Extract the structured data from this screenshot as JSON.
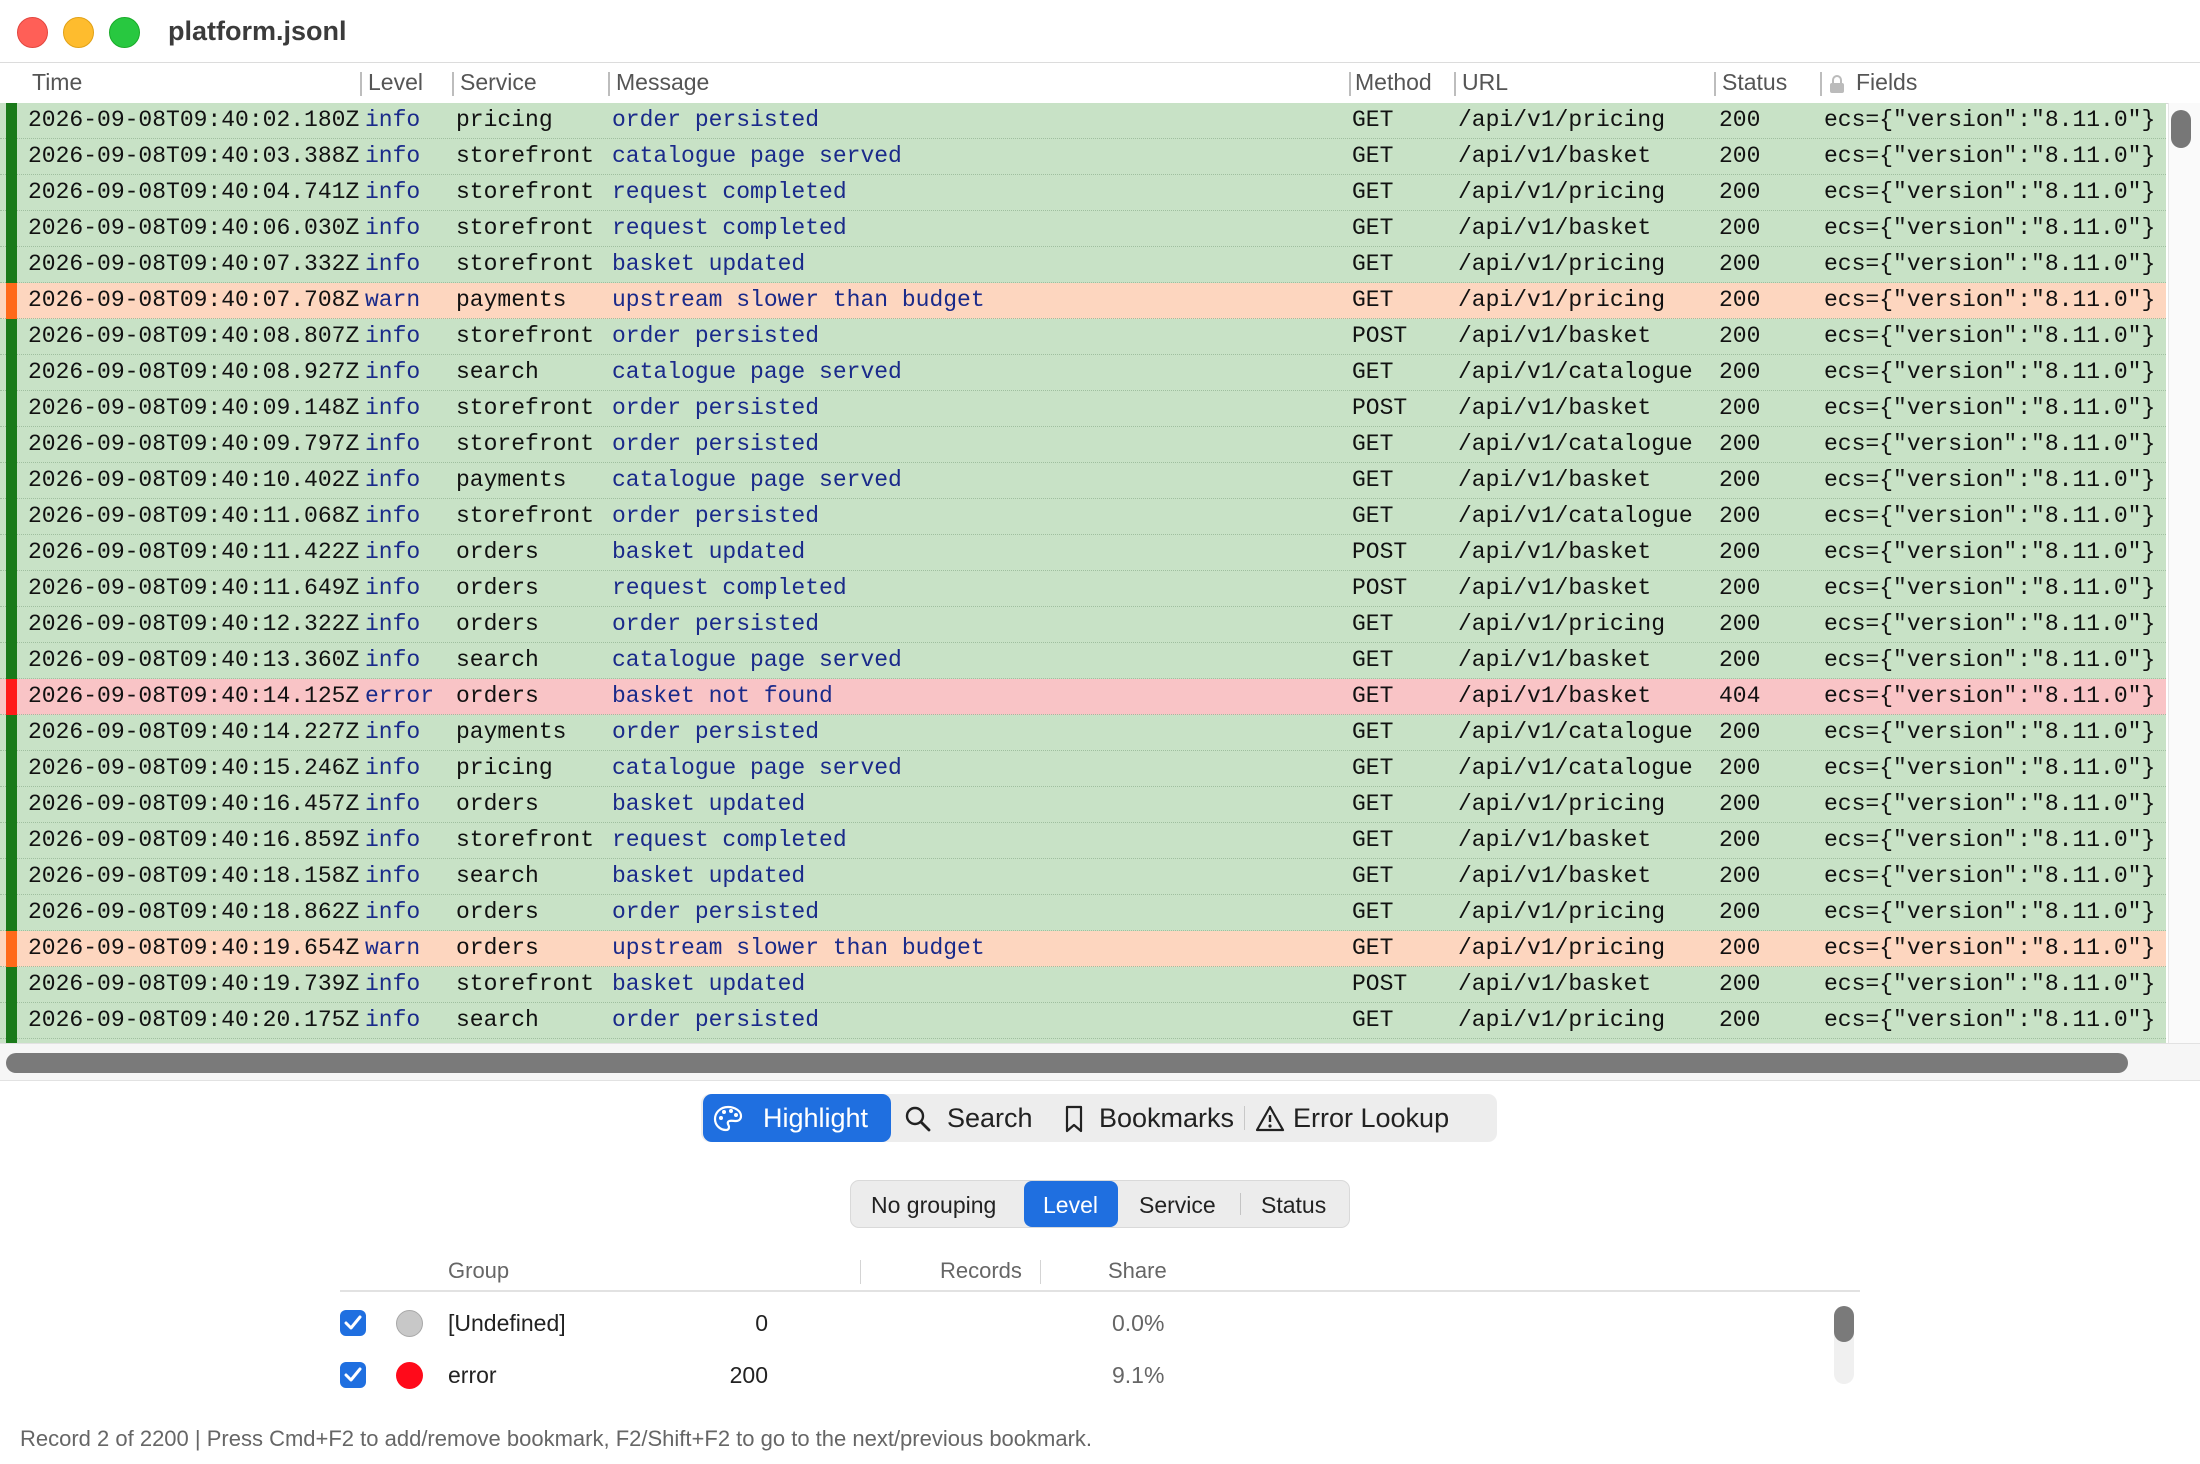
{
  "window": {
    "title": "platform.jsonl"
  },
  "columns": {
    "time": "Time",
    "level": "Level",
    "service": "Service",
    "message": "Message",
    "method": "Method",
    "url": "URL",
    "status": "Status",
    "fields": "Fields"
  },
  "level_colors": {
    "info": "#1a7a1a",
    "warn": "#ff6a1a",
    "error": "#ff1a1a"
  },
  "rows": [
    {
      "time": "2026-09-08T09:40:02.180Z",
      "level": "info",
      "service": "pricing",
      "message": "order persisted",
      "method": "GET",
      "url": "/api/v1/pricing",
      "status": "200",
      "fields": "ecs={\"version\":\"8.11.0\"}"
    },
    {
      "time": "2026-09-08T09:40:03.388Z",
      "level": "info",
      "service": "storefront",
      "message": "catalogue page served",
      "method": "GET",
      "url": "/api/v1/basket",
      "status": "200",
      "fields": "ecs={\"version\":\"8.11.0\"}"
    },
    {
      "time": "2026-09-08T09:40:04.741Z",
      "level": "info",
      "service": "storefront",
      "message": "request completed",
      "method": "GET",
      "url": "/api/v1/pricing",
      "status": "200",
      "fields": "ecs={\"version\":\"8.11.0\"}"
    },
    {
      "time": "2026-09-08T09:40:06.030Z",
      "level": "info",
      "service": "storefront",
      "message": "request completed",
      "method": "GET",
      "url": "/api/v1/basket",
      "status": "200",
      "fields": "ecs={\"version\":\"8.11.0\"}"
    },
    {
      "time": "2026-09-08T09:40:07.332Z",
      "level": "info",
      "service": "storefront",
      "message": "basket updated",
      "method": "GET",
      "url": "/api/v1/pricing",
      "status": "200",
      "fields": "ecs={\"version\":\"8.11.0\"}"
    },
    {
      "time": "2026-09-08T09:40:07.708Z",
      "level": "warn",
      "service": "payments",
      "message": "upstream slower than budget",
      "method": "GET",
      "url": "/api/v1/pricing",
      "status": "200",
      "fields": "ecs={\"version\":\"8.11.0\"}"
    },
    {
      "time": "2026-09-08T09:40:08.807Z",
      "level": "info",
      "service": "storefront",
      "message": "order persisted",
      "method": "POST",
      "url": "/api/v1/basket",
      "status": "200",
      "fields": "ecs={\"version\":\"8.11.0\"}"
    },
    {
      "time": "2026-09-08T09:40:08.927Z",
      "level": "info",
      "service": "search",
      "message": "catalogue page served",
      "method": "GET",
      "url": "/api/v1/catalogue",
      "status": "200",
      "fields": "ecs={\"version\":\"8.11.0\"}"
    },
    {
      "time": "2026-09-08T09:40:09.148Z",
      "level": "info",
      "service": "storefront",
      "message": "order persisted",
      "method": "POST",
      "url": "/api/v1/basket",
      "status": "200",
      "fields": "ecs={\"version\":\"8.11.0\"}"
    },
    {
      "time": "2026-09-08T09:40:09.797Z",
      "level": "info",
      "service": "storefront",
      "message": "order persisted",
      "method": "GET",
      "url": "/api/v1/catalogue",
      "status": "200",
      "fields": "ecs={\"version\":\"8.11.0\"}"
    },
    {
      "time": "2026-09-08T09:40:10.402Z",
      "level": "info",
      "service": "payments",
      "message": "catalogue page served",
      "method": "GET",
      "url": "/api/v1/basket",
      "status": "200",
      "fields": "ecs={\"version\":\"8.11.0\"}"
    },
    {
      "time": "2026-09-08T09:40:11.068Z",
      "level": "info",
      "service": "storefront",
      "message": "order persisted",
      "method": "GET",
      "url": "/api/v1/catalogue",
      "status": "200",
      "fields": "ecs={\"version\":\"8.11.0\"}"
    },
    {
      "time": "2026-09-08T09:40:11.422Z",
      "level": "info",
      "service": "orders",
      "message": "basket updated",
      "method": "POST",
      "url": "/api/v1/basket",
      "status": "200",
      "fields": "ecs={\"version\":\"8.11.0\"}"
    },
    {
      "time": "2026-09-08T09:40:11.649Z",
      "level": "info",
      "service": "orders",
      "message": "request completed",
      "method": "POST",
      "url": "/api/v1/basket",
      "status": "200",
      "fields": "ecs={\"version\":\"8.11.0\"}"
    },
    {
      "time": "2026-09-08T09:40:12.322Z",
      "level": "info",
      "service": "orders",
      "message": "order persisted",
      "method": "GET",
      "url": "/api/v1/pricing",
      "status": "200",
      "fields": "ecs={\"version\":\"8.11.0\"}"
    },
    {
      "time": "2026-09-08T09:40:13.360Z",
      "level": "info",
      "service": "search",
      "message": "catalogue page served",
      "method": "GET",
      "url": "/api/v1/basket",
      "status": "200",
      "fields": "ecs={\"version\":\"8.11.0\"}"
    },
    {
      "time": "2026-09-08T09:40:14.125Z",
      "level": "error",
      "service": "orders",
      "message": "basket not found",
      "method": "GET",
      "url": "/api/v1/basket",
      "status": "404",
      "fields": "ecs={\"version\":\"8.11.0\"}"
    },
    {
      "time": "2026-09-08T09:40:14.227Z",
      "level": "info",
      "service": "payments",
      "message": "order persisted",
      "method": "GET",
      "url": "/api/v1/catalogue",
      "status": "200",
      "fields": "ecs={\"version\":\"8.11.0\"}"
    },
    {
      "time": "2026-09-08T09:40:15.246Z",
      "level": "info",
      "service": "pricing",
      "message": "catalogue page served",
      "method": "GET",
      "url": "/api/v1/catalogue",
      "status": "200",
      "fields": "ecs={\"version\":\"8.11.0\"}"
    },
    {
      "time": "2026-09-08T09:40:16.457Z",
      "level": "info",
      "service": "orders",
      "message": "basket updated",
      "method": "GET",
      "url": "/api/v1/pricing",
      "status": "200",
      "fields": "ecs={\"version\":\"8.11.0\"}"
    },
    {
      "time": "2026-09-08T09:40:16.859Z",
      "level": "info",
      "service": "storefront",
      "message": "request completed",
      "method": "GET",
      "url": "/api/v1/basket",
      "status": "200",
      "fields": "ecs={\"version\":\"8.11.0\"}"
    },
    {
      "time": "2026-09-08T09:40:18.158Z",
      "level": "info",
      "service": "search",
      "message": "basket updated",
      "method": "GET",
      "url": "/api/v1/basket",
      "status": "200",
      "fields": "ecs={\"version\":\"8.11.0\"}"
    },
    {
      "time": "2026-09-08T09:40:18.862Z",
      "level": "info",
      "service": "orders",
      "message": "order persisted",
      "method": "GET",
      "url": "/api/v1/pricing",
      "status": "200",
      "fields": "ecs={\"version\":\"8.11.0\"}"
    },
    {
      "time": "2026-09-08T09:40:19.654Z",
      "level": "warn",
      "service": "orders",
      "message": "upstream slower than budget",
      "method": "GET",
      "url": "/api/v1/pricing",
      "status": "200",
      "fields": "ecs={\"version\":\"8.11.0\"}"
    },
    {
      "time": "2026-09-08T09:40:19.739Z",
      "level": "info",
      "service": "storefront",
      "message": "basket updated",
      "method": "POST",
      "url": "/api/v1/basket",
      "status": "200",
      "fields": "ecs={\"version\":\"8.11.0\"}"
    },
    {
      "time": "2026-09-08T09:40:20.175Z",
      "level": "info",
      "service": "search",
      "message": "order persisted",
      "method": "GET",
      "url": "/api/v1/pricing",
      "status": "200",
      "fields": "ecs={\"version\":\"8.11.0\"}"
    }
  ],
  "tabs": [
    {
      "label": "Highlight",
      "icon": "palette-icon",
      "active": true
    },
    {
      "label": "Search",
      "icon": "magnifier-icon",
      "active": false
    },
    {
      "label": "Bookmarks",
      "icon": "bookmark-icon",
      "active": false
    },
    {
      "label": "Error Lookup",
      "icon": "warning-icon",
      "active": false
    }
  ],
  "grouping": {
    "options": [
      "No grouping",
      "Level",
      "Service",
      "Status"
    ],
    "selected": "Level"
  },
  "groups_table": {
    "headers": {
      "group": "Group",
      "records": "Records",
      "share": "Share"
    },
    "rows": [
      {
        "checked": true,
        "color": "#c8c8c8",
        "name": "[Undefined]",
        "records": "0",
        "share": "0.0%"
      },
      {
        "checked": true,
        "color": "#ff0a1a",
        "name": "error",
        "records": "200",
        "share": "9.1%"
      }
    ]
  },
  "status_bar": "Record 2 of 2200   |   Press Cmd+F2 to add/remove bookmark, F2/Shift+F2 to go to the next/previous bookmark."
}
